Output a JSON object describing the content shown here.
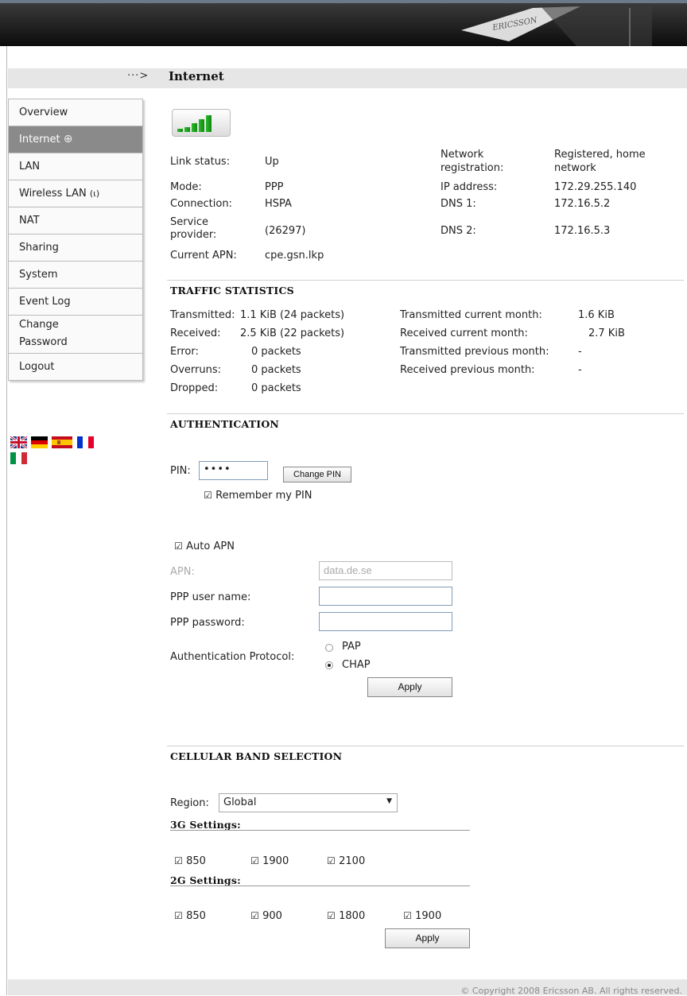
{
  "header": {
    "logo_text": "ERICSSON"
  },
  "page_title": "Internet",
  "nav_arrow": "···>",
  "nav": [
    {
      "label": "Overview",
      "icon": null
    },
    {
      "label": "Internet",
      "icon": "globe-icon",
      "active": true
    },
    {
      "label": "LAN",
      "icon": null
    },
    {
      "label": "Wireless LAN",
      "icon": "antenna-icon"
    },
    {
      "label": "NAT",
      "icon": null
    },
    {
      "label": "Sharing",
      "icon": null
    },
    {
      "label": "System",
      "icon": null
    },
    {
      "label": "Event Log",
      "icon": null
    },
    {
      "label": "Change Password",
      "icon": null
    },
    {
      "label": "Logout",
      "icon": null
    }
  ],
  "flags": [
    "uk-flag",
    "germany-flag",
    "spain-flag",
    "france-flag",
    "italy-flag"
  ],
  "signal": {
    "bars": 5,
    "level": 5,
    "color": "#22a022"
  },
  "status": {
    "link_status_label": "Link status:",
    "link_status": "Up",
    "mode_label": "Mode:",
    "mode": "PPP",
    "connection_label": "Connection:",
    "connection": "HSPA",
    "provider_label": "Service provider:",
    "provider": "(26297)",
    "apn_label": "Current APN:",
    "apn": "cpe.gsn.lkp",
    "netreg_label": "Network registration:",
    "netreg": "Registered, home network",
    "ip_label": "IP address:",
    "ip": "172.29.255.140",
    "dns1_label": "DNS 1:",
    "dns1": "172.16.5.2",
    "dns2_label": "DNS 2:",
    "dns2": "172.16.5.3"
  },
  "traffic": {
    "title": "TRAFFIC STATISTICS",
    "tx_label": "Transmitted:",
    "tx": "1.1 KiB (24 packets)",
    "rx_label": "Received:",
    "rx": "2.5 KiB (22 packets)",
    "err_label": "Error:",
    "err": "0 packets",
    "ovr_label": "Overruns:",
    "ovr": "0 packets",
    "drop_label": "Dropped:",
    "drop": "0 packets",
    "txcm_label": "Transmitted current month:",
    "txcm": "1.6 KiB",
    "rxcm_label": "Received current month:",
    "rxcm": "2.7 KiB",
    "txpm_label": "Transmitted previous month:",
    "txpm": "-",
    "rxpm_label": "Received previous month:",
    "rxpm": "-"
  },
  "auth": {
    "title": "AUTHENTICATION",
    "pin_label": "PIN:",
    "pin_value": "••••",
    "change_pin": "Change PIN",
    "remember_pin": "Remember my PIN",
    "auto_apn": "Auto APN",
    "apn_label": "APN:",
    "apn_value": "data.de.se",
    "ppp_user_label": "PPP user name:",
    "ppp_user_value": "",
    "ppp_pass_label": "PPP password:",
    "ppp_pass_value": "",
    "protocol_label": "Authentication Protocol:",
    "pap": "PAP",
    "chap": "CHAP",
    "selected": "CHAP",
    "apply": "Apply"
  },
  "band": {
    "title": "CELLULAR BAND SELECTION",
    "region_label": "Region:",
    "region_value": "Global",
    "g3_title": "3G Settings:",
    "g3": [
      "850",
      "1900",
      "2100"
    ],
    "g2_title": "2G Settings:",
    "g2": [
      "850",
      "900",
      "1800",
      "1900"
    ],
    "apply": "Apply"
  },
  "footer": {
    "copyright": "© Copyright 2008 Ericsson AB. All rights reserved."
  }
}
